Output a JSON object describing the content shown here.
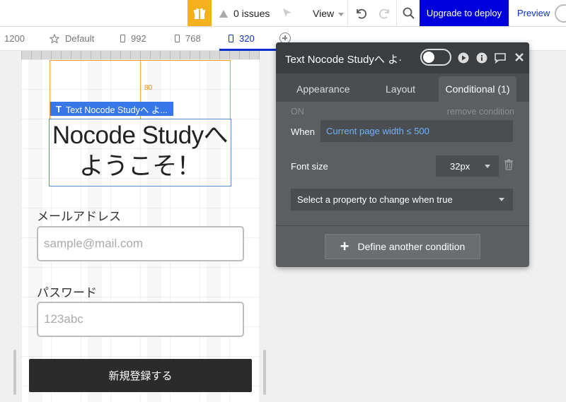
{
  "toolbar": {
    "issues": "0 issues",
    "view_label": "View",
    "upgrade_label": "Upgrade to deploy",
    "preview_label": "Preview"
  },
  "breakpoints": [
    {
      "label": "1200",
      "icon": "none"
    },
    {
      "label": "Default",
      "icon": "star-icon"
    },
    {
      "label": "992",
      "icon": "tablet-icon"
    },
    {
      "label": "768",
      "icon": "tablet-icon"
    },
    {
      "label": "320",
      "icon": "phone-icon",
      "active": true
    }
  ],
  "canvas": {
    "guide_value": "80",
    "selected_tag": "Text Nocode Studyへ よ...",
    "heading": "Nocode Studyへ ようこそ！",
    "email_label": "メールアドレス",
    "email_placeholder": "sample@mail.com",
    "password_label": "パスワード",
    "password_placeholder": "123abc",
    "submit_label": "新規登録する"
  },
  "editor": {
    "title": "Text Nocode Studyへ よ·",
    "tabs": [
      "Appearance",
      "Layout",
      "Conditional (1)"
    ],
    "active_tab": "Conditional (1)",
    "on_label": "ON",
    "remove_label": "remove condition",
    "when_label": "When",
    "when_value": "Current page width ≤ 500",
    "font_size_label": "Font size",
    "font_size_value": "32px",
    "property_placeholder": "Select a property to change when true",
    "define_label": "Define another condition"
  },
  "colors": {
    "accent_blue": "#0000dd",
    "link_blue": "#0a2fcc",
    "selection_blue": "#3778e8",
    "gift_yellow": "#f5b020",
    "guide_orange": "#f0a030",
    "editor_bg": "#5b5f61"
  }
}
